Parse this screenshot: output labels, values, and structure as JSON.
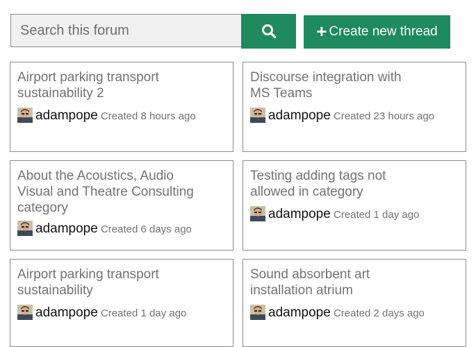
{
  "search": {
    "placeholder": "Search this forum"
  },
  "toolbar": {
    "create_label": "Create new thread"
  },
  "threads": [
    {
      "title": "Airport parking transport sustainability 2",
      "user": "adampope",
      "created": "Created 8 hours ago"
    },
    {
      "title": "Discourse integration with MS Teams",
      "user": "adampope",
      "created": "Created 23 hours ago"
    },
    {
      "title": "About the Acoustics, Audio Visual and Theatre Consulting category",
      "user": "adampope",
      "created": "Created 6 days ago"
    },
    {
      "title": "Testing adding tags not allowed in category",
      "user": "adampope",
      "created": "Created 1 day ago"
    },
    {
      "title": "Airport parking transport sustainability",
      "user": "adampope",
      "created": "Created 1 day ago"
    },
    {
      "title": "Sound absorbent art installation atrium",
      "user": "adampope",
      "created": "Created 2 days ago"
    }
  ],
  "colors": {
    "accent": "#1e8a5e",
    "card_border": "#8c8c8c",
    "muted_text": "#737373"
  }
}
